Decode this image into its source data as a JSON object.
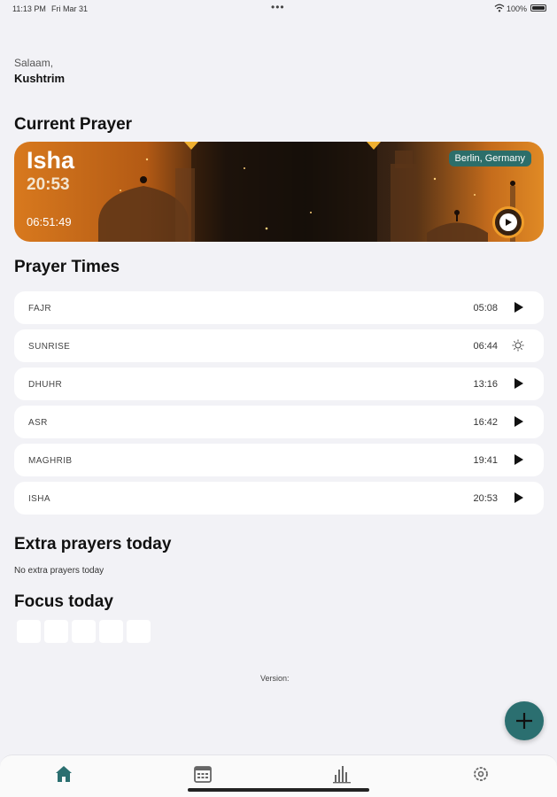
{
  "status_bar": {
    "time": "11:13 PM",
    "date": "Fri Mar 31",
    "dots": "•••",
    "battery": "100%"
  },
  "greeting": "Salaam,",
  "username": "Kushtrim",
  "current_prayer": {
    "section_title": "Current Prayer",
    "name": "Isha",
    "time": "20:53",
    "countdown": "06:51:49",
    "location": "Berlin, Germany"
  },
  "prayer_times": {
    "section_title": "Prayer Times",
    "rows": [
      {
        "name": "FAJR",
        "time": "05:08",
        "icon": "play-icon"
      },
      {
        "name": "SUNRISE",
        "time": "06:44",
        "icon": "sun-icon"
      },
      {
        "name": "DHUHR",
        "time": "13:16",
        "icon": "play-icon"
      },
      {
        "name": "ASR",
        "time": "16:42",
        "icon": "play-icon"
      },
      {
        "name": "MAGHRIB",
        "time": "19:41",
        "icon": "play-icon"
      },
      {
        "name": "ISHA",
        "time": "20:53",
        "icon": "play-icon"
      }
    ]
  },
  "extra_prayers": {
    "section_title": "Extra prayers today",
    "empty_text": "No extra prayers today"
  },
  "focus": {
    "section_title": "Focus today",
    "box_count": 5
  },
  "version_label": "Version:",
  "tabs": [
    {
      "name": "home",
      "icon": "home-icon",
      "active": true
    },
    {
      "name": "calendar",
      "icon": "calendar-icon",
      "active": false
    },
    {
      "name": "stats",
      "icon": "chart-icon",
      "active": false
    },
    {
      "name": "settings",
      "icon": "gear-icon",
      "active": false
    }
  ],
  "colors": {
    "accent": "#2b6f70",
    "background": "#f2f2f6",
    "card_orange": "#d8791e"
  }
}
